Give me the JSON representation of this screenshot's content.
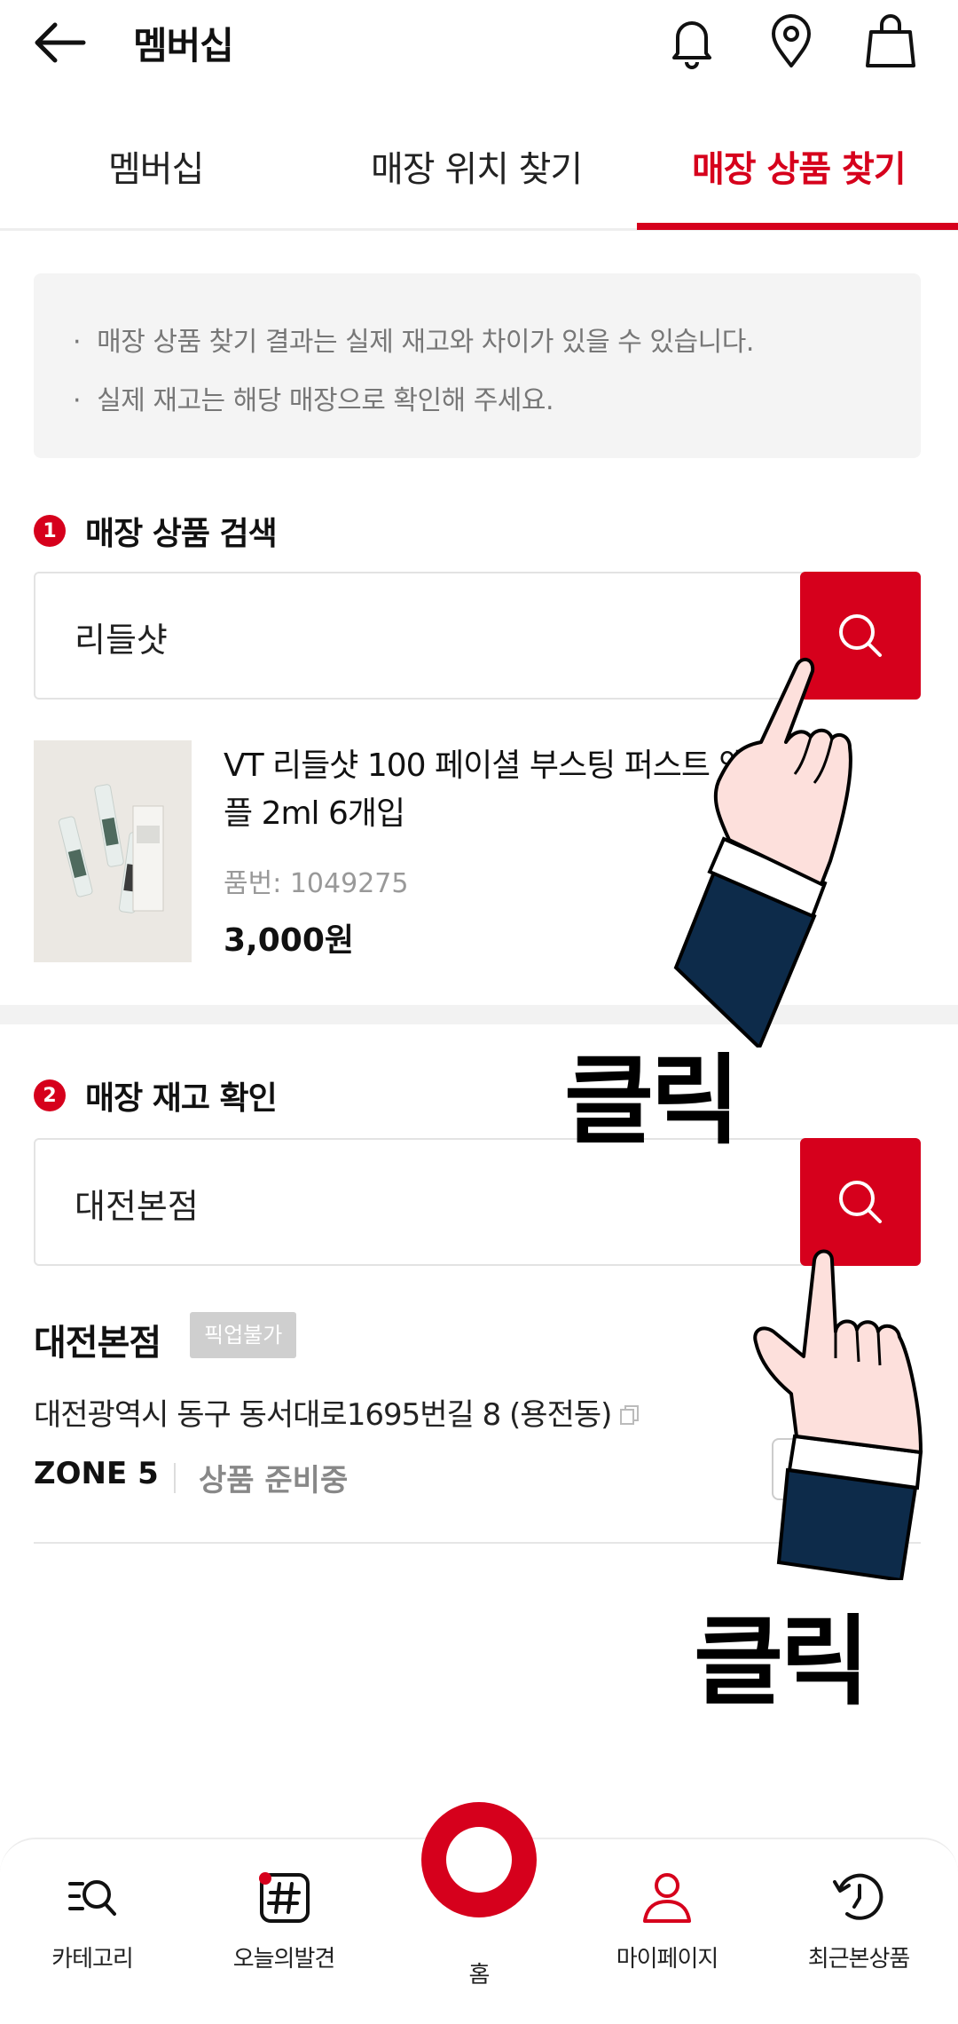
{
  "header": {
    "title": "멤버십"
  },
  "tabs": [
    {
      "label": "멤버십",
      "active": false
    },
    {
      "label": "매장 위치 찾기",
      "active": false
    },
    {
      "label": "매장 상품 찾기",
      "active": true
    }
  ],
  "notice": [
    "매장 상품 찾기 결과는 실제 재고와 차이가 있을 수 있습니다.",
    "실제 재고는 해당 매장으로 확인해 주세요."
  ],
  "section1": {
    "number": "1",
    "title": "매장 상품 검색",
    "search_value": "리들샷"
  },
  "product": {
    "name": "VT 리들샷 100 페이셜 부스팅 퍼스트 앰플 2ml 6개입",
    "code": "품번: 1049275",
    "price": "3,000원"
  },
  "section2": {
    "number": "2",
    "title": "매장 재고 확인",
    "search_value": "대전본점"
  },
  "store": {
    "name": "대전본점",
    "badge": "픽업불가",
    "address": "대전광역시 동구 동서대로1695번길 8 (용전동)",
    "zone": "ZONE 5",
    "status": "상품 준비중"
  },
  "overlay": {
    "click1": "클릭",
    "click2": "클릭"
  },
  "nav": [
    {
      "label": "카테고리",
      "icon": "category-search-icon"
    },
    {
      "label": "오늘의발견",
      "icon": "hashtag-icon"
    },
    {
      "label": "홈",
      "icon": "home-ring-icon"
    },
    {
      "label": "마이페이지",
      "icon": "person-icon"
    },
    {
      "label": "최근본상품",
      "icon": "history-icon"
    }
  ],
  "colors": {
    "accent": "#d6001c",
    "notice_bg": "#f4f4f4",
    "hand_sleeve": "#0d2b4a",
    "hand_skin": "#fde0dc"
  }
}
